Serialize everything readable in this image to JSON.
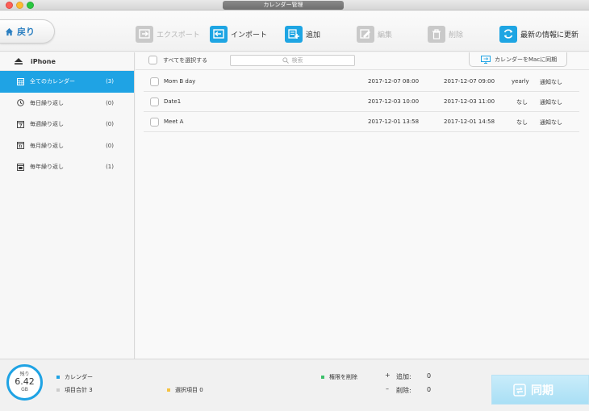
{
  "window": {
    "title": "カレンダー管理"
  },
  "toolbar": {
    "back_label": "戻り",
    "export_label": "エクスポート",
    "import_label": "インポート",
    "add_label": "追加",
    "edit_label": "編集",
    "delete_label": "削除",
    "refresh_label": "最新の情報に更新"
  },
  "sidebar": {
    "device": "iPhone",
    "items": [
      {
        "label": "全てのカレンダー",
        "count": "(3)",
        "icon": "calendar-grid-icon",
        "active": true
      },
      {
        "label": "毎日繰り返し",
        "count": "(0)",
        "icon": "clock-repeat-icon"
      },
      {
        "label": "毎週繰り返し",
        "count": "(0)",
        "icon": "calendar-7-icon"
      },
      {
        "label": "毎月繰り返し",
        "count": "(0)",
        "icon": "calendar-31-icon"
      },
      {
        "label": "毎年繰り返し",
        "count": "(1)",
        "icon": "calendar-year-icon"
      }
    ]
  },
  "main": {
    "select_all_label": "すべてを選択する",
    "search_placeholder": "検索",
    "sync_to_mac_label": "カレンダーをMacに同期",
    "events": [
      {
        "title": "Mom  B day",
        "start": "2017-12-07 08:00",
        "end": "2017-12-07 09:00",
        "repeat": "yearly",
        "alert": "通知なし"
      },
      {
        "title": "Date1",
        "start": "2017-12-03 10:00",
        "end": "2017-12-03 11:00",
        "repeat": "なし",
        "alert": "通知なし"
      },
      {
        "title": "Meet A",
        "start": "2017-12-01 13:58",
        "end": "2017-12-01 14:58",
        "repeat": "なし",
        "alert": "通知なし"
      }
    ]
  },
  "footer": {
    "storage_label": "残り",
    "storage_value": "6.42",
    "storage_unit": "GB",
    "legend_calendar": "カレンダー",
    "legend_total": "項目合計 3",
    "legend_selected": "選択項目 0",
    "legend_delete_rights": "権限を削除",
    "add_label": "追加:",
    "add_value": "0",
    "remove_label": "削除:",
    "remove_value": "0",
    "sync_label": "同期"
  },
  "colors": {
    "accent": "#1fa3e4",
    "calendar_dot": "#1fa3e4",
    "total_dot": "#cccccc",
    "selected_dot": "#f5c242",
    "delete_rights_dot": "#3cc06a"
  }
}
